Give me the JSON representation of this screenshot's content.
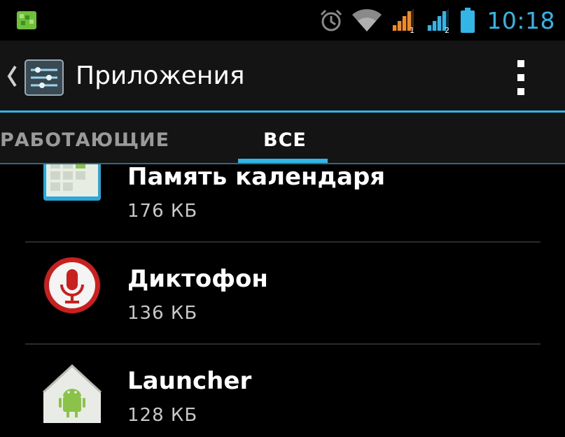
{
  "status_bar": {
    "time": "10:18",
    "icons": [
      "notification-app-icon",
      "alarm-icon",
      "wifi-icon",
      "signal-sim1-icon",
      "signal-sim2-icon",
      "battery-icon"
    ],
    "sim1_label": "1",
    "sim2_label": "2"
  },
  "action_bar": {
    "title": "Приложения",
    "icons": [
      "back-chevron-icon",
      "settings-app-icon",
      "overflow-menu-icon"
    ]
  },
  "tabs": [
    {
      "label": "РАБОТАЮЩИЕ",
      "selected": false
    },
    {
      "label": "ВСЕ",
      "selected": true
    }
  ],
  "apps": [
    {
      "name": "Память календаря",
      "size": "176 КБ",
      "icon": "calendar-storage-icon"
    },
    {
      "name": "Диктофон",
      "size": "136 КБ",
      "icon": "voice-recorder-icon"
    },
    {
      "name": "Launcher",
      "size": "128 КБ",
      "icon": "launcher-icon"
    }
  ],
  "colors": {
    "accent": "#33b5e5",
    "background": "#000000",
    "action_bar": "#141414",
    "signal_orange": "#f08a24"
  }
}
